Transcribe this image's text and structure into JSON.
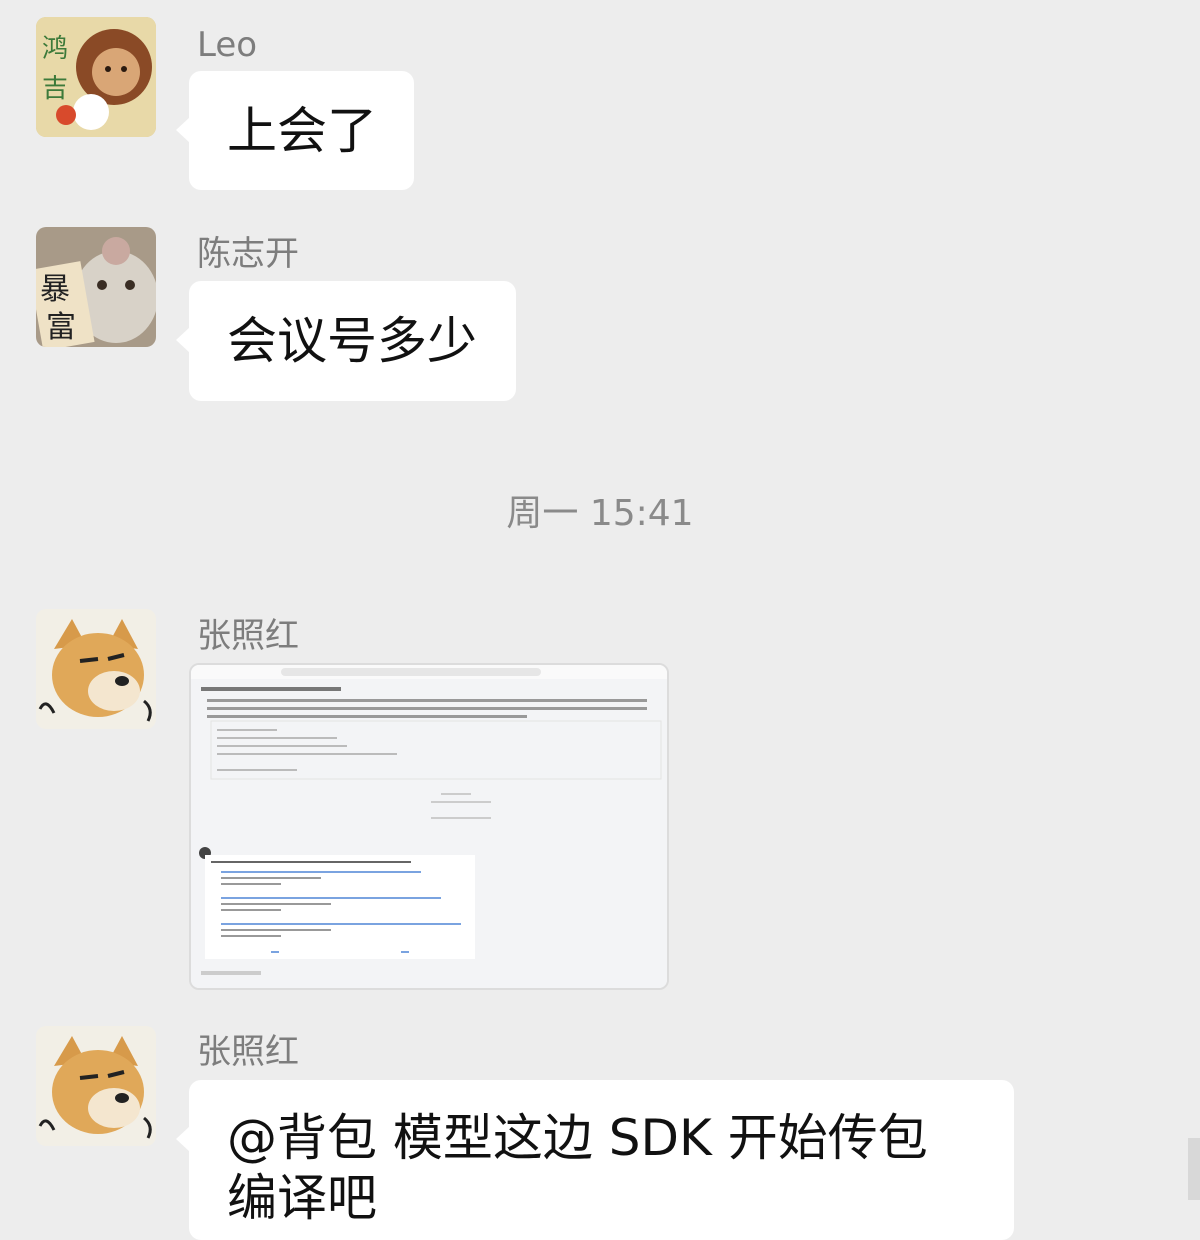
{
  "messages": [
    {
      "sender": "Leo",
      "text": "上会了",
      "avatar": "monkey-avatar-icon"
    },
    {
      "sender": "陈志开",
      "text": "会议号多少",
      "avatar": "cat-avatar-icon"
    },
    {
      "sender": "张照红",
      "text": "",
      "avatar": "doge-avatar-icon",
      "attachment": "screenshot-image"
    },
    {
      "sender": "张照红",
      "text": "@背包  模型这边 SDK 开始传包编译吧",
      "avatar": "doge-avatar-icon"
    }
  ],
  "timestamp": "周一 15:41",
  "colors": {
    "background": "#ededed",
    "bubble": "#ffffff",
    "sender": "#7d7d7d",
    "time": "#8a8a8a"
  }
}
